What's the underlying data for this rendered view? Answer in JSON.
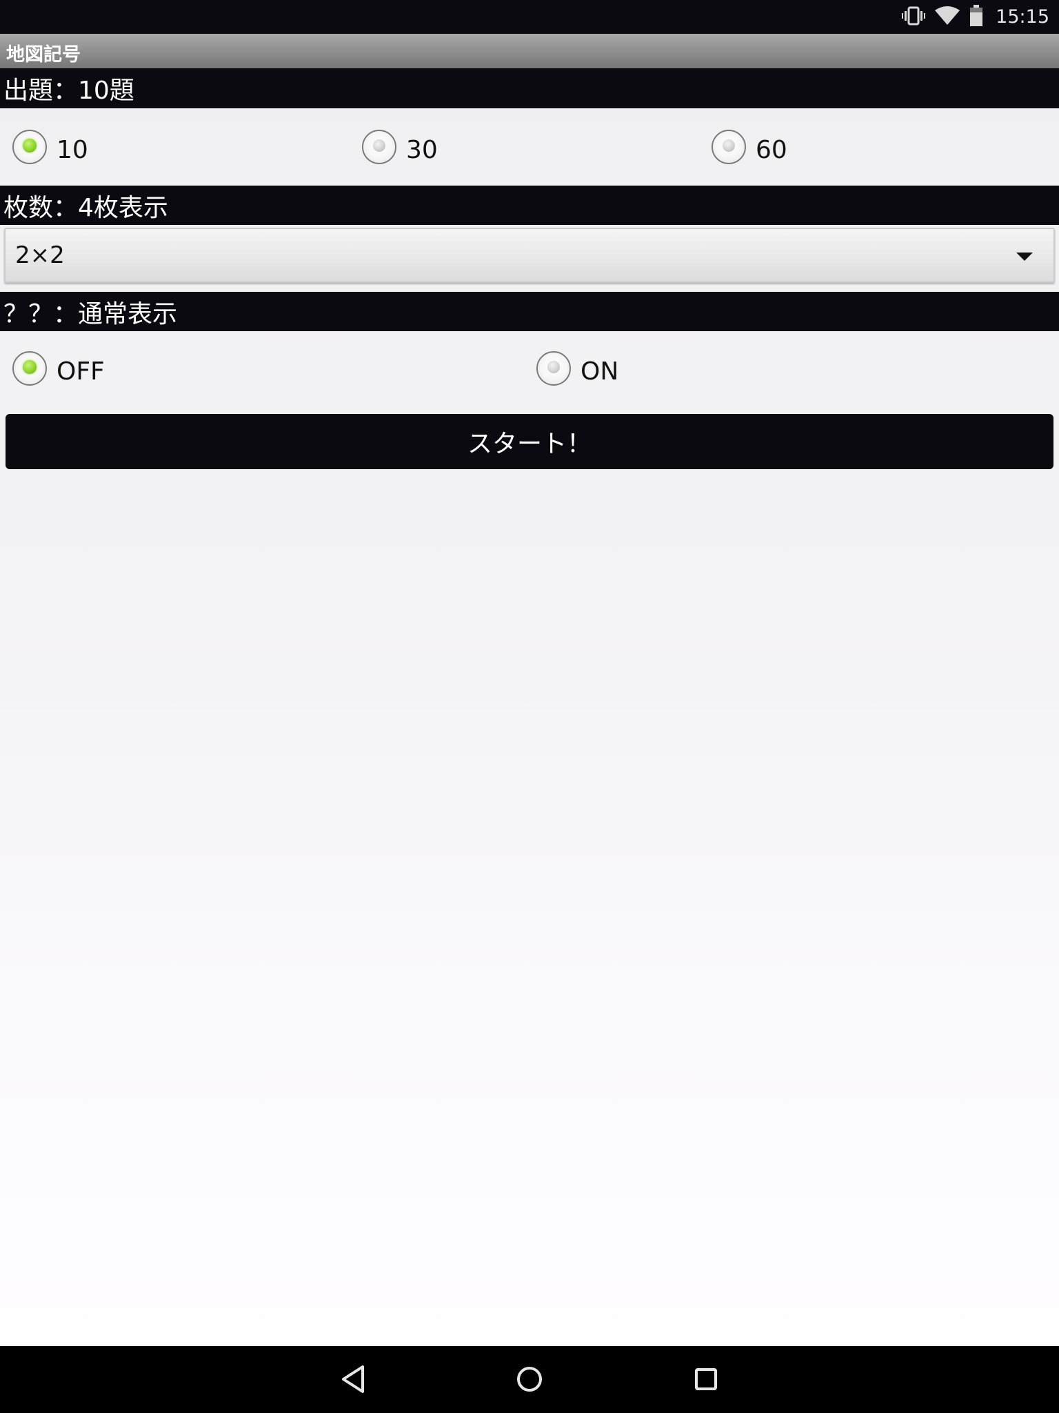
{
  "status_bar": {
    "time": "15:15",
    "icons": [
      "vibrate-icon",
      "wifi-icon",
      "battery-icon"
    ]
  },
  "title_bar": {
    "title": "地図記号"
  },
  "question_section": {
    "header": "出題：10題",
    "options": [
      {
        "label": "10",
        "selected": true
      },
      {
        "label": "30",
        "selected": false
      },
      {
        "label": "60",
        "selected": false
      }
    ]
  },
  "cards_section": {
    "header": "枚数：4枚表示",
    "dropdown_value": "2×2"
  },
  "display_section": {
    "header": "？？：通常表示",
    "options": [
      {
        "label": "OFF",
        "selected": true
      },
      {
        "label": "ON",
        "selected": false
      }
    ]
  },
  "start_button": {
    "label": "スタート！"
  },
  "nav_bar": {
    "icons": [
      "back-icon",
      "home-icon",
      "recents-icon"
    ]
  },
  "colors": {
    "bar_background": "#0b0a10",
    "radio_selected": "#8fd52a",
    "title_bar": "#8d8d8d"
  }
}
